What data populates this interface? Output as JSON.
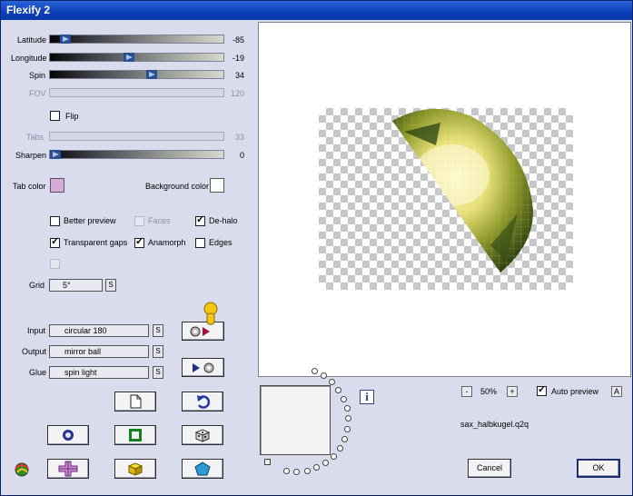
{
  "window": {
    "title": "Flexify 2"
  },
  "sliders": [
    {
      "id": "latitude",
      "label": "Latitude",
      "value": "-85",
      "pos": 0.06,
      "enabled": true
    },
    {
      "id": "longitude",
      "label": "Longitude",
      "value": "-19",
      "pos": 0.45,
      "enabled": true
    },
    {
      "id": "spin",
      "label": "Spin",
      "value": "34",
      "pos": 0.59,
      "enabled": true
    },
    {
      "id": "fov",
      "label": "FOV",
      "value": "120",
      "enabled": false
    },
    {
      "id": "tabs",
      "label": "Tabs",
      "value": "33",
      "enabled": false
    },
    {
      "id": "sharpen",
      "label": "Sharpen",
      "value": "0",
      "pos": 0.0,
      "enabled": true
    }
  ],
  "flip": {
    "label": "Flip",
    "checked": false
  },
  "colors": {
    "tab_label": "Tab color",
    "tab_value": "#d8a8d8",
    "bg_label": "Background color",
    "bg_value": "#ffffff"
  },
  "options": {
    "better_preview": {
      "label": "Better preview",
      "checked": false
    },
    "faces": {
      "label": "Faces",
      "checked": false
    },
    "dehalo": {
      "label": "De-halo",
      "checked": true
    },
    "transparent_gaps": {
      "label": "Transparent gaps",
      "checked": true
    },
    "anamorph": {
      "label": "Anamorph",
      "checked": true
    },
    "edges": {
      "label": "Edges",
      "checked": false
    }
  },
  "grid": {
    "label": "Grid",
    "value": "5°",
    "s": "S"
  },
  "mapping": {
    "input_label": "Input",
    "input_value": "circular 180",
    "output_label": "Output",
    "output_value": "mirror ball",
    "glue_label": "Glue",
    "glue_value": "spin light",
    "s": "S"
  },
  "zoom": {
    "minus": "-",
    "value": "50%",
    "plus": "+"
  },
  "auto_preview": {
    "label": "Auto preview",
    "checked": true,
    "a": "A"
  },
  "info": "i",
  "preset_file": "sax_halbkugel.q2q",
  "buttons": {
    "cancel": "Cancel",
    "ok": "OK"
  },
  "accent": "#0b3fb8"
}
